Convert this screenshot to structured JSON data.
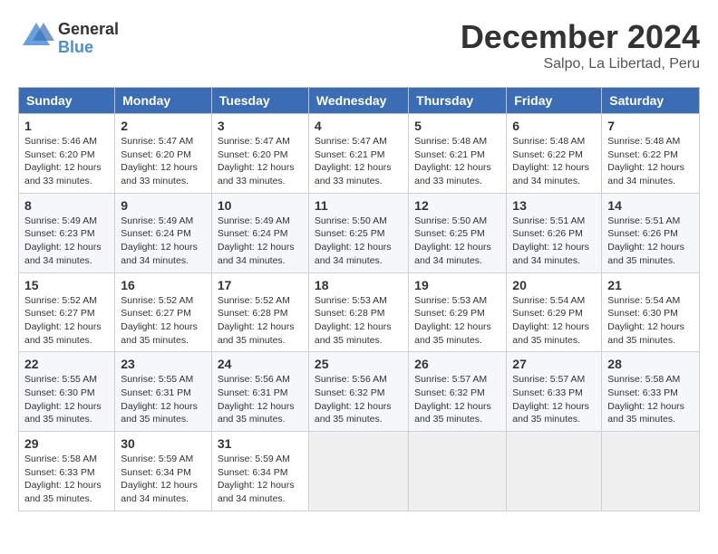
{
  "logo": {
    "general": "General",
    "blue": "Blue"
  },
  "header": {
    "month": "December 2024",
    "location": "Salpo, La Libertad, Peru"
  },
  "weekdays": [
    "Sunday",
    "Monday",
    "Tuesday",
    "Wednesday",
    "Thursday",
    "Friday",
    "Saturday"
  ],
  "weeks": [
    [
      {
        "day": "1",
        "sunrise": "5:46 AM",
        "sunset": "6:20 PM",
        "daylight": "12 hours and 33 minutes."
      },
      {
        "day": "2",
        "sunrise": "5:47 AM",
        "sunset": "6:20 PM",
        "daylight": "12 hours and 33 minutes."
      },
      {
        "day": "3",
        "sunrise": "5:47 AM",
        "sunset": "6:20 PM",
        "daylight": "12 hours and 33 minutes."
      },
      {
        "day": "4",
        "sunrise": "5:47 AM",
        "sunset": "6:21 PM",
        "daylight": "12 hours and 33 minutes."
      },
      {
        "day": "5",
        "sunrise": "5:48 AM",
        "sunset": "6:21 PM",
        "daylight": "12 hours and 33 minutes."
      },
      {
        "day": "6",
        "sunrise": "5:48 AM",
        "sunset": "6:22 PM",
        "daylight": "12 hours and 34 minutes."
      },
      {
        "day": "7",
        "sunrise": "5:48 AM",
        "sunset": "6:22 PM",
        "daylight": "12 hours and 34 minutes."
      }
    ],
    [
      {
        "day": "8",
        "sunrise": "5:49 AM",
        "sunset": "6:23 PM",
        "daylight": "12 hours and 34 minutes."
      },
      {
        "day": "9",
        "sunrise": "5:49 AM",
        "sunset": "6:24 PM",
        "daylight": "12 hours and 34 minutes."
      },
      {
        "day": "10",
        "sunrise": "5:49 AM",
        "sunset": "6:24 PM",
        "daylight": "12 hours and 34 minutes."
      },
      {
        "day": "11",
        "sunrise": "5:50 AM",
        "sunset": "6:25 PM",
        "daylight": "12 hours and 34 minutes."
      },
      {
        "day": "12",
        "sunrise": "5:50 AM",
        "sunset": "6:25 PM",
        "daylight": "12 hours and 34 minutes."
      },
      {
        "day": "13",
        "sunrise": "5:51 AM",
        "sunset": "6:26 PM",
        "daylight": "12 hours and 34 minutes."
      },
      {
        "day": "14",
        "sunrise": "5:51 AM",
        "sunset": "6:26 PM",
        "daylight": "12 hours and 35 minutes."
      }
    ],
    [
      {
        "day": "15",
        "sunrise": "5:52 AM",
        "sunset": "6:27 PM",
        "daylight": "12 hours and 35 minutes."
      },
      {
        "day": "16",
        "sunrise": "5:52 AM",
        "sunset": "6:27 PM",
        "daylight": "12 hours and 35 minutes."
      },
      {
        "day": "17",
        "sunrise": "5:52 AM",
        "sunset": "6:28 PM",
        "daylight": "12 hours and 35 minutes."
      },
      {
        "day": "18",
        "sunrise": "5:53 AM",
        "sunset": "6:28 PM",
        "daylight": "12 hours and 35 minutes."
      },
      {
        "day": "19",
        "sunrise": "5:53 AM",
        "sunset": "6:29 PM",
        "daylight": "12 hours and 35 minutes."
      },
      {
        "day": "20",
        "sunrise": "5:54 AM",
        "sunset": "6:29 PM",
        "daylight": "12 hours and 35 minutes."
      },
      {
        "day": "21",
        "sunrise": "5:54 AM",
        "sunset": "6:30 PM",
        "daylight": "12 hours and 35 minutes."
      }
    ],
    [
      {
        "day": "22",
        "sunrise": "5:55 AM",
        "sunset": "6:30 PM",
        "daylight": "12 hours and 35 minutes."
      },
      {
        "day": "23",
        "sunrise": "5:55 AM",
        "sunset": "6:31 PM",
        "daylight": "12 hours and 35 minutes."
      },
      {
        "day": "24",
        "sunrise": "5:56 AM",
        "sunset": "6:31 PM",
        "daylight": "12 hours and 35 minutes."
      },
      {
        "day": "25",
        "sunrise": "5:56 AM",
        "sunset": "6:32 PM",
        "daylight": "12 hours and 35 minutes."
      },
      {
        "day": "26",
        "sunrise": "5:57 AM",
        "sunset": "6:32 PM",
        "daylight": "12 hours and 35 minutes."
      },
      {
        "day": "27",
        "sunrise": "5:57 AM",
        "sunset": "6:33 PM",
        "daylight": "12 hours and 35 minutes."
      },
      {
        "day": "28",
        "sunrise": "5:58 AM",
        "sunset": "6:33 PM",
        "daylight": "12 hours and 35 minutes."
      }
    ],
    [
      {
        "day": "29",
        "sunrise": "5:58 AM",
        "sunset": "6:33 PM",
        "daylight": "12 hours and 35 minutes."
      },
      {
        "day": "30",
        "sunrise": "5:59 AM",
        "sunset": "6:34 PM",
        "daylight": "12 hours and 34 minutes."
      },
      {
        "day": "31",
        "sunrise": "5:59 AM",
        "sunset": "6:34 PM",
        "daylight": "12 hours and 34 minutes."
      },
      null,
      null,
      null,
      null
    ]
  ],
  "labels": {
    "sunrise": "Sunrise:",
    "sunset": "Sunset:",
    "daylight": "Daylight:"
  }
}
